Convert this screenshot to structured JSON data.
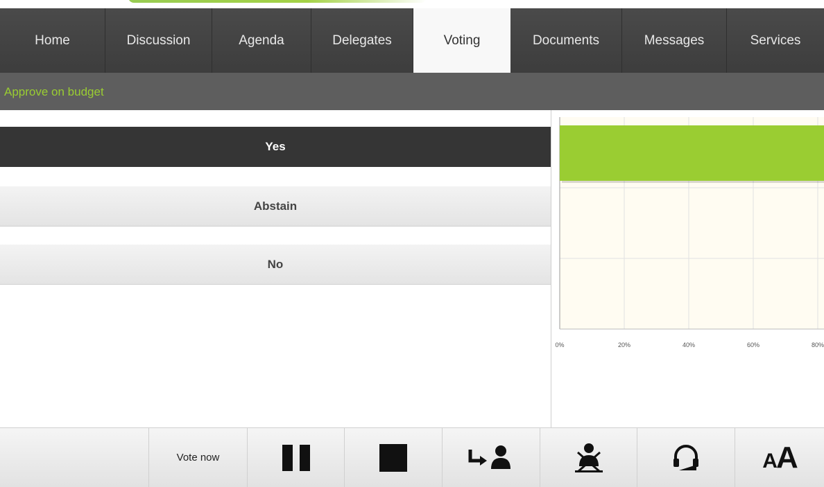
{
  "nav": {
    "tabs": [
      {
        "label": "Home",
        "active": false
      },
      {
        "label": "Discussion",
        "active": false
      },
      {
        "label": "Agenda",
        "active": false
      },
      {
        "label": "Delegates",
        "active": false
      },
      {
        "label": "Voting",
        "active": true
      },
      {
        "label": "Documents",
        "active": false
      },
      {
        "label": "Messages",
        "active": false
      },
      {
        "label": "Services",
        "active": false
      }
    ]
  },
  "motion": {
    "title": "Approve on budget"
  },
  "options": {
    "yes": "Yes",
    "abstain": "Abstain",
    "no": "No",
    "selected": "Yes"
  },
  "chart_data": {
    "type": "bar",
    "orientation": "horizontal",
    "categories": [
      "Yes",
      "Abstain",
      "No"
    ],
    "values": [
      100,
      0,
      0
    ],
    "ticks": [
      "0%",
      "20%",
      "40%",
      "60%",
      "80%"
    ],
    "xlim": [
      0,
      100
    ],
    "grid": true,
    "bar_color": "#9acd32",
    "plot_bg": "#fffcf2"
  },
  "footer": {
    "vote_now_label": "Vote now",
    "icons": [
      "pause-icon",
      "stop-icon",
      "assign-delegate-icon",
      "remove-delegate-icon",
      "headset-icon",
      "text-size-icon"
    ],
    "text_size_small": "A",
    "text_size_large": "A"
  },
  "colors": {
    "accent": "#9acd32",
    "nav_bg": "#444444",
    "selected_option_bg": "#353535"
  }
}
